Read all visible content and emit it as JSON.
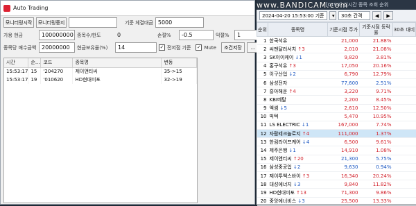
{
  "window": {
    "title": "Auto Trading"
  },
  "controls": {
    "row1": {
      "monitor_start": "모니터링시작",
      "monitor_stop": "모니터링중지",
      "base_amount_label": "기준 체결대금",
      "base_amount_value": "5000"
    },
    "row2": {
      "buy_cash_label": "가용 현금",
      "buy_cash_value": "100000000",
      "trade_count_label": "종목수/한도",
      "trade_count_value": "0",
      "loss_label": "손절%",
      "loss_value": "-0.5",
      "profit_label": "익절%",
      "profit_value": "1"
    },
    "row3": {
      "per_stock_label": "종목당 매수금액",
      "per_stock_value": "20000000",
      "ratio_label": "현금보유율(%)",
      "ratio_value": "14",
      "prev_day_label": "전저점 기준",
      "mute_label": "Mute",
      "condition_button": "조건저장",
      "more_button": "..."
    }
  },
  "log_table": {
    "headers": [
      "시간",
      "순...",
      "코드",
      "종목명",
      "변동"
    ],
    "rows": [
      {
        "time": "15:53:17",
        "rank": "15",
        "code": "'204270",
        "name": "제이앤티씨",
        "change": "35->15"
      },
      {
        "time": "15:53:17",
        "rank": "19",
        "code": "'010620",
        "name": "HD현대미포",
        "change": "32->19"
      }
    ]
  },
  "realtime": {
    "title": "[0198] 실시간 종목 조회 순위",
    "watermark": "www.BANDICAM.com",
    "datetime": "2024-04-20 15:53:00 기준",
    "interval": "30초 간격",
    "headers": [
      "순위",
      "종목명",
      "기준시점 주가",
      "기준시점 등락률",
      "30초 대비"
    ],
    "rows": [
      {
        "rank": "1",
        "name": "한국석유",
        "dir": "",
        "move": "",
        "price": "21,000",
        "pct": "21.88%",
        "cls": "up"
      },
      {
        "rank": "2",
        "name": "씨젠달러서치",
        "dir": "↑",
        "move": "3",
        "price": "2,010",
        "pct": "21.08%",
        "cls": "up"
      },
      {
        "rank": "3",
        "name": "SK이이케이",
        "dir": "↓",
        "move": "1",
        "price": "9,820",
        "pct": "3.81%",
        "cls": "up"
      },
      {
        "rank": "4",
        "name": "홍구석유",
        "dir": "↑",
        "move": "3",
        "price": "17,050",
        "pct": "20.16%",
        "cls": "up"
      },
      {
        "rank": "5",
        "name": "이구산업",
        "dir": "↓",
        "move": "2",
        "price": "6,790",
        "pct": "12.79%",
        "cls": "up"
      },
      {
        "rank": "6",
        "name": "삼성전자",
        "dir": "",
        "move": "",
        "price": "77,600",
        "pct": "2.51%",
        "cls": "down"
      },
      {
        "rank": "7",
        "name": "흥아해운",
        "dir": "↑",
        "move": "4",
        "price": "3,220",
        "pct": "9.71%",
        "cls": "up"
      },
      {
        "rank": "8",
        "name": "KBI메탈",
        "dir": "",
        "move": "",
        "price": "2,200",
        "pct": "8.45%",
        "cls": "up"
      },
      {
        "rank": "9",
        "name": "엑셈",
        "dir": "↓",
        "move": "5",
        "price": "2,610",
        "pct": "12.50%",
        "cls": "up"
      },
      {
        "rank": "10",
        "name": "빅텍",
        "dir": "",
        "move": "",
        "price": "5,470",
        "pct": "10.95%",
        "cls": "up"
      },
      {
        "rank": "11",
        "name": "LS ELECTRIC",
        "dir": "↓",
        "move": "1",
        "price": "167,000",
        "pct": "7.74%",
        "cls": "up"
      },
      {
        "rank": "12",
        "name": "자람테크놀로지",
        "dir": "↑",
        "move": "4",
        "price": "111,000",
        "pct": "1.37%",
        "cls": "up"
      },
      {
        "rank": "13",
        "name": "한컴라이프케어",
        "dir": "↓",
        "move": "4",
        "price": "6,500",
        "pct": "9.61%",
        "cls": "up"
      },
      {
        "rank": "14",
        "name": "제주은행",
        "dir": "↓",
        "move": "1",
        "price": "14,910",
        "pct": "1.08%",
        "cls": "up"
      },
      {
        "rank": "15",
        "name": "제이앤티씨",
        "dir": "↑",
        "move": "20",
        "price": "21,300",
        "pct": "5.75%",
        "cls": "down"
      },
      {
        "rank": "16",
        "name": "삼성중공업",
        "dir": "↓",
        "move": "2",
        "price": "9,630",
        "pct": "0.94%",
        "cls": "down"
      },
      {
        "rank": "17",
        "name": "제이투엑스바이",
        "dir": "↑",
        "move": "3",
        "price": "16,340",
        "pct": "20.24%",
        "cls": "up"
      },
      {
        "rank": "18",
        "name": "대성에너지",
        "dir": "↓",
        "move": "3",
        "price": "9,840",
        "pct": "11.82%",
        "cls": "up"
      },
      {
        "rank": "19",
        "name": "HD현대미포",
        "dir": "↑",
        "move": "13",
        "price": "71,300",
        "pct": "9.86%",
        "cls": "up"
      },
      {
        "rank": "20",
        "name": "중앙에너비스",
        "dir": "↓",
        "move": "3",
        "price": "25,500",
        "pct": "13.33%",
        "cls": "up"
      }
    ]
  },
  "colors": {
    "up": "#d2202a",
    "down": "#1a56c2",
    "selected_row": "#cfe6f7"
  }
}
